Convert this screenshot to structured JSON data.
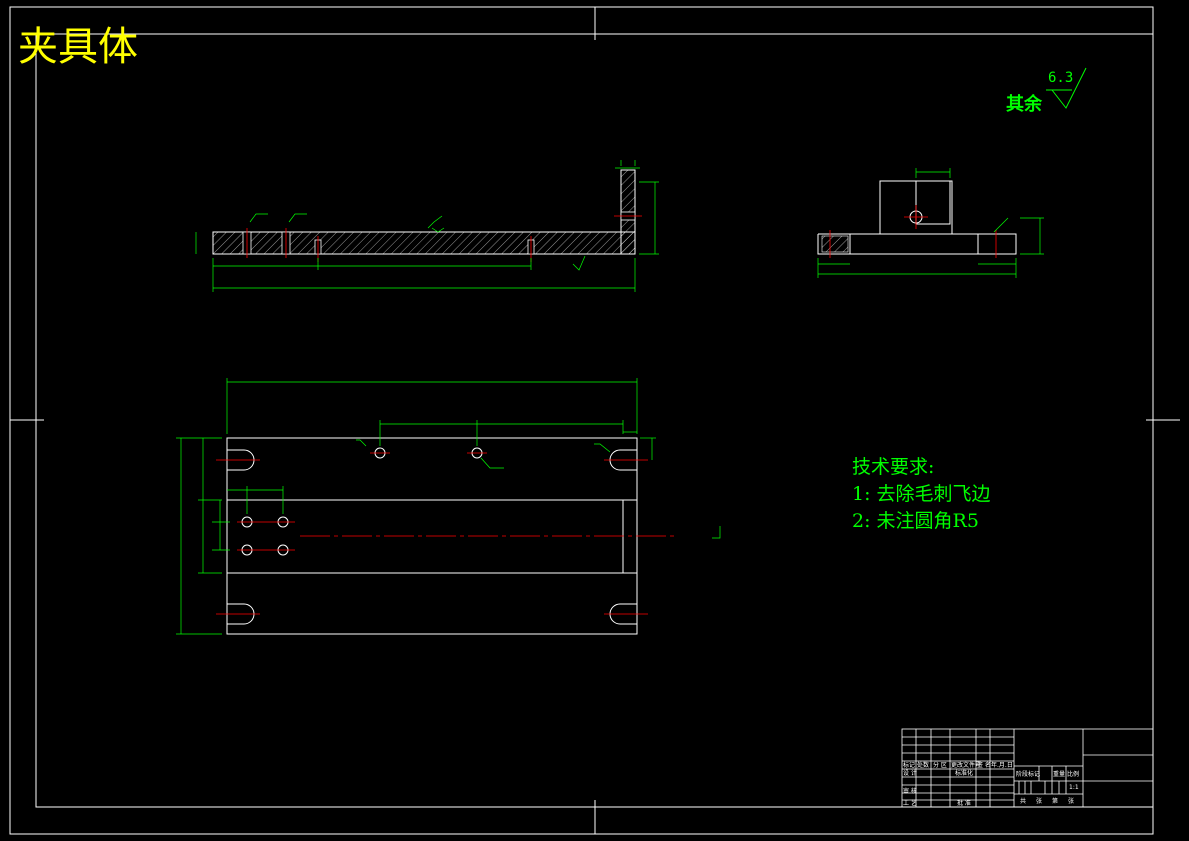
{
  "title": "夹具体",
  "roughness": {
    "label": "其余",
    "value": "6.3"
  },
  "technical_requirements": {
    "heading": "技术要求:",
    "items": [
      "1: 去除毛刺飞边",
      "2: 未注圆角R5"
    ]
  },
  "title_block": {
    "row1": [
      "标记",
      "处数",
      "分 区",
      "更改文件号",
      "签 名",
      "年.月.日"
    ],
    "row2": [
      "设 计",
      "标准化"
    ],
    "stage": [
      "阶段标记",
      "重量",
      "比例"
    ],
    "review": "审 核",
    "process": "工 艺",
    "approve": "批 准",
    "sheet": [
      "共",
      "张",
      "第",
      "张"
    ],
    "scale": "1:1"
  },
  "colors": {
    "frame": "#ffffff",
    "dimension": "#00ff00",
    "centerline": "#ff0000",
    "title": "#ffff00"
  }
}
